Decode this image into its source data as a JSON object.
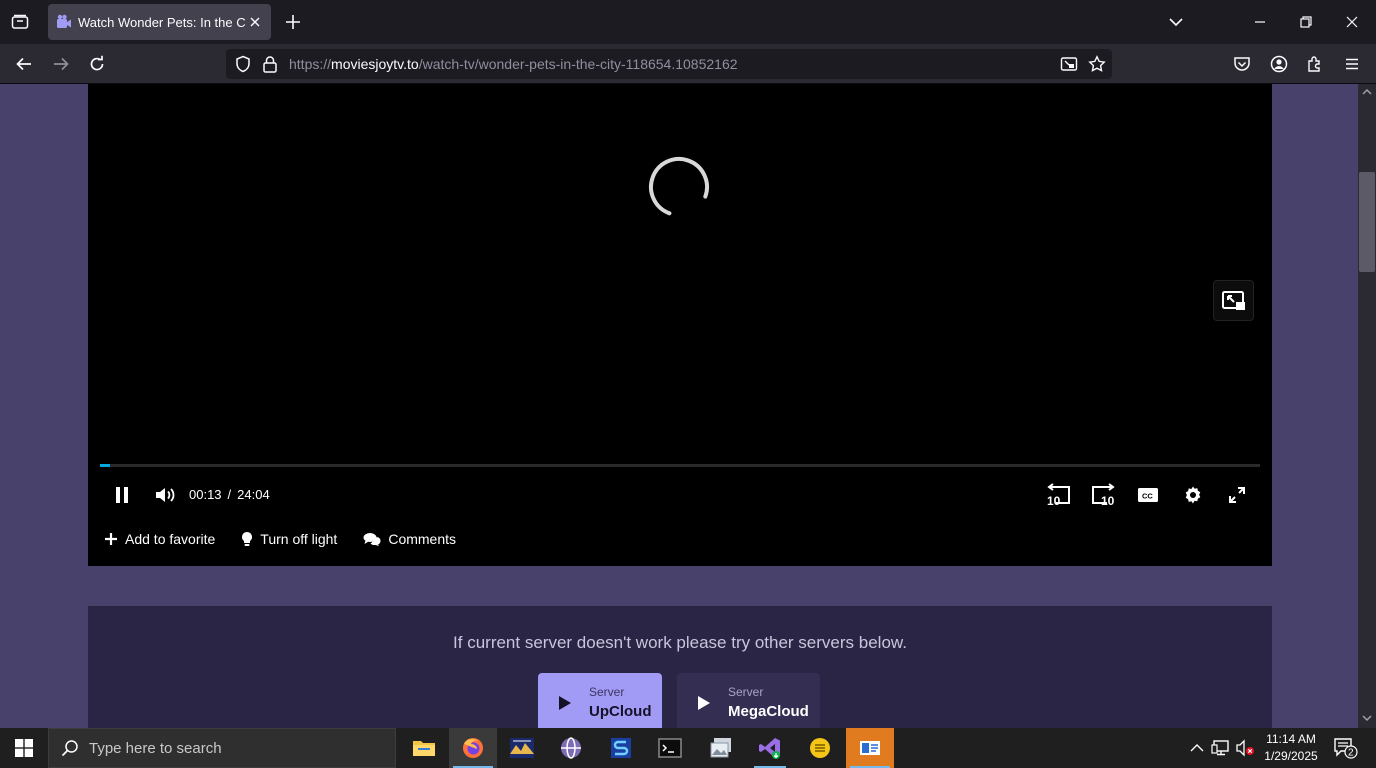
{
  "browser": {
    "tab_title": "Watch Wonder Pets: In the City",
    "url_prefix": "https://",
    "url_domain": "moviesjoytv.to",
    "url_path": "/watch-tv/wonder-pets-in-the-city-118654.10852162"
  },
  "player": {
    "current_time": "00:13",
    "separator": "/",
    "duration": "24:04",
    "progress_fraction": 0.009,
    "rewind_label": "10",
    "forward_label": "10",
    "cc_label": "CC"
  },
  "actions": [
    {
      "label": "Add to favorite",
      "icon": "plus-icon"
    },
    {
      "label": "Turn off light",
      "icon": "lightbulb-icon"
    },
    {
      "label": "Comments",
      "icon": "comments-icon"
    }
  ],
  "servers": {
    "message": "If current server doesn't work please try other servers below.",
    "items": [
      {
        "label": "Server",
        "name": "UpCloud",
        "active": true
      },
      {
        "label": "Server",
        "name": "MegaCloud",
        "active": false
      }
    ]
  },
  "taskbar": {
    "search_placeholder": "Type here to search",
    "time": "11:14 AM",
    "date": "1/29/2025",
    "notification_count": "2"
  },
  "colors": {
    "page_bg": "#47416b",
    "server_panel": "#2a2545",
    "active_server": "#a29bf5",
    "progress": "#00a8e1"
  }
}
